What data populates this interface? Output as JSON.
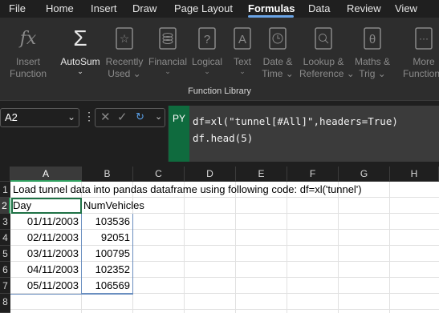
{
  "menubar": {
    "items": [
      "File",
      "Home",
      "Insert",
      "Draw",
      "Page Layout",
      "Formulas",
      "Data",
      "Review",
      "View"
    ],
    "active": "Formulas"
  },
  "ribbon": {
    "buttons": [
      {
        "line1": "Insert",
        "line2": "Function",
        "icon": "fx-icon"
      },
      {
        "line1": "AutoSum",
        "icon": "sigma-icon"
      },
      {
        "line1": "Recently",
        "line2": "Used",
        "icon": "star-book-icon"
      },
      {
        "line1": "Financial",
        "icon": "coins-book-icon"
      },
      {
        "line1": "Logical",
        "icon": "question-book-icon"
      },
      {
        "line1": "Text",
        "icon": "text-a-book-icon"
      },
      {
        "line1": "Date &",
        "line2": "Time",
        "icon": "clock-book-icon"
      },
      {
        "line1": "Lookup &",
        "line2": "Reference",
        "icon": "search-book-icon"
      },
      {
        "line1": "Maths &",
        "line2": "Trig",
        "icon": "theta-book-icon"
      },
      {
        "line1": "More",
        "line2": "Functions",
        "icon": "more-book-icon"
      }
    ],
    "group_label": "Function Library"
  },
  "formula_bar": {
    "name_box": "A2",
    "python_badge": "PY",
    "code_line1": "df=xl(\"tunnel[#All]\",headers=True)",
    "code_line2": "df.head(5)"
  },
  "grid": {
    "columns": [
      "A",
      "B",
      "C",
      "D",
      "E",
      "F",
      "G",
      "H"
    ],
    "rows": [
      "1",
      "2",
      "3",
      "4",
      "5",
      "6",
      "7",
      "8"
    ],
    "a1": "Load tunnel data into pandas dataframe using following code: df=xl('tunnel')",
    "header_day": "Day",
    "header_vehicles": "NumVehicles",
    "data": [
      {
        "day": "01/11/2003",
        "vehicles": "103536"
      },
      {
        "day": "02/11/2003",
        "vehicles": "92051"
      },
      {
        "day": "03/11/2003",
        "vehicles": "100795"
      },
      {
        "day": "04/11/2003",
        "vehicles": "102352"
      },
      {
        "day": "05/11/2003",
        "vehicles": "106569"
      }
    ]
  },
  "colors": {
    "accent_green": "#1e7145",
    "python_badge": "#0f6b3e",
    "menu_underline": "#6aa4e6"
  }
}
